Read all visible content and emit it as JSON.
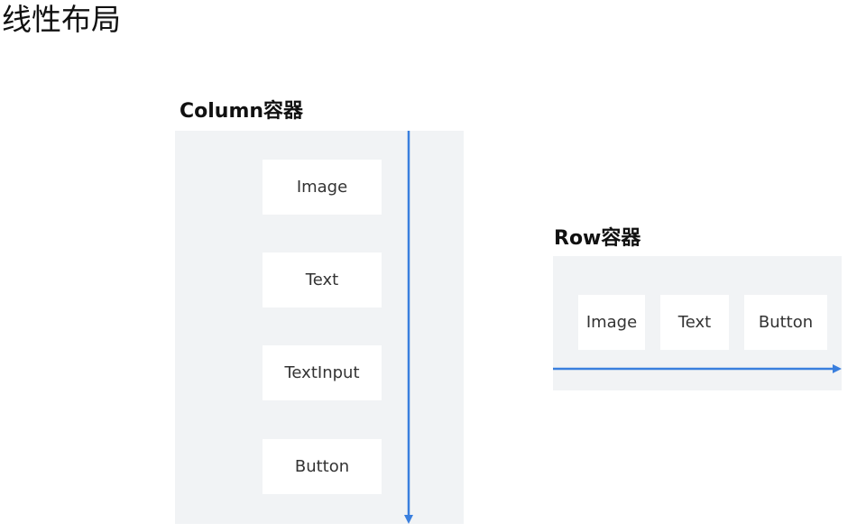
{
  "title": "线性布局",
  "colors": {
    "container_bg": "#f1f3f5",
    "item_bg": "#ffffff",
    "arrow": "#3a7fde",
    "text": "#333333"
  },
  "column_container": {
    "label": "Column容器",
    "items": [
      "Image",
      "Text",
      "TextInput",
      "Button"
    ],
    "axis_direction": "vertical-down"
  },
  "row_container": {
    "label": "Row容器",
    "items": [
      "Image",
      "Text",
      "Button"
    ],
    "axis_direction": "horizontal-right"
  }
}
